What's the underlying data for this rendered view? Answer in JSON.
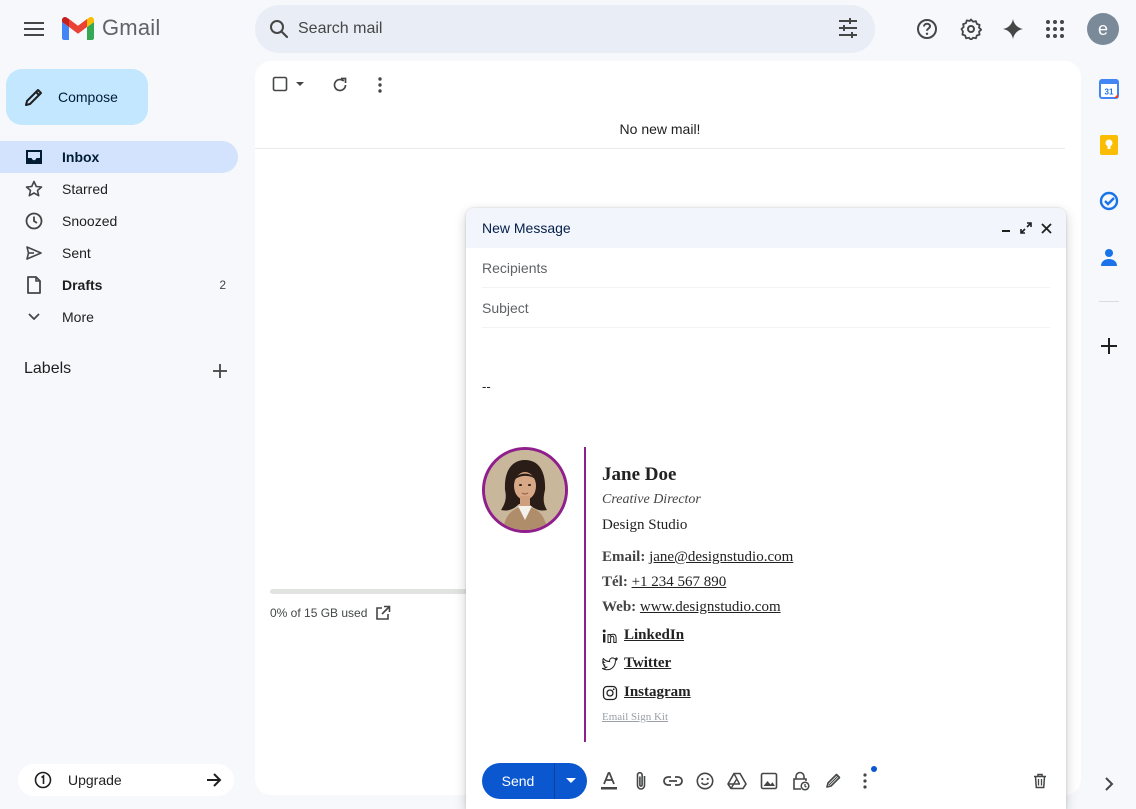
{
  "app": {
    "name": "Gmail"
  },
  "search": {
    "placeholder": "Search mail"
  },
  "header": {
    "avatar_letter": "e"
  },
  "compose_button": {
    "label": "Compose"
  },
  "nav": [
    {
      "label": "Inbox",
      "count": "",
      "icon": "inbox-icon",
      "active": true
    },
    {
      "label": "Starred",
      "count": "",
      "icon": "star-icon"
    },
    {
      "label": "Snoozed",
      "count": "",
      "icon": "clock-icon"
    },
    {
      "label": "Sent",
      "count": "",
      "icon": "send-icon"
    },
    {
      "label": "Drafts",
      "count": "2",
      "icon": "draft-icon"
    },
    {
      "label": "More",
      "count": "",
      "icon": "chevron-down-icon"
    }
  ],
  "labels": {
    "title": "Labels"
  },
  "upgrade": {
    "label": "Upgrade"
  },
  "main": {
    "empty_message": "No new mail!",
    "storage_text": "0% of 15 GB used",
    "storage_percent": 0
  },
  "compose": {
    "title": "New Message",
    "recipients_placeholder": "Recipients",
    "subject_placeholder": "Subject",
    "signature_separator": "--",
    "send_label": "Send"
  },
  "signature": {
    "name": "Jane Doe",
    "role": "Creative Director",
    "company": "Design Studio",
    "email_label": "Email:",
    "email": "jane@designstudio.com",
    "phone_label": "Tél:",
    "phone": "+1 234 567 890",
    "web_label": "Web:",
    "web": "www.designstudio.com",
    "linkedin": "LinkedIn",
    "twitter": "Twitter",
    "instagram": "Instagram",
    "credit": "Email Sign Kit",
    "accent_color": "#8e1f8c"
  },
  "colors": {
    "background": "#f6f8fc",
    "compose_button": "#c2e7ff",
    "active_nav": "#d3e3fd",
    "send_button": "#0b57d0"
  }
}
